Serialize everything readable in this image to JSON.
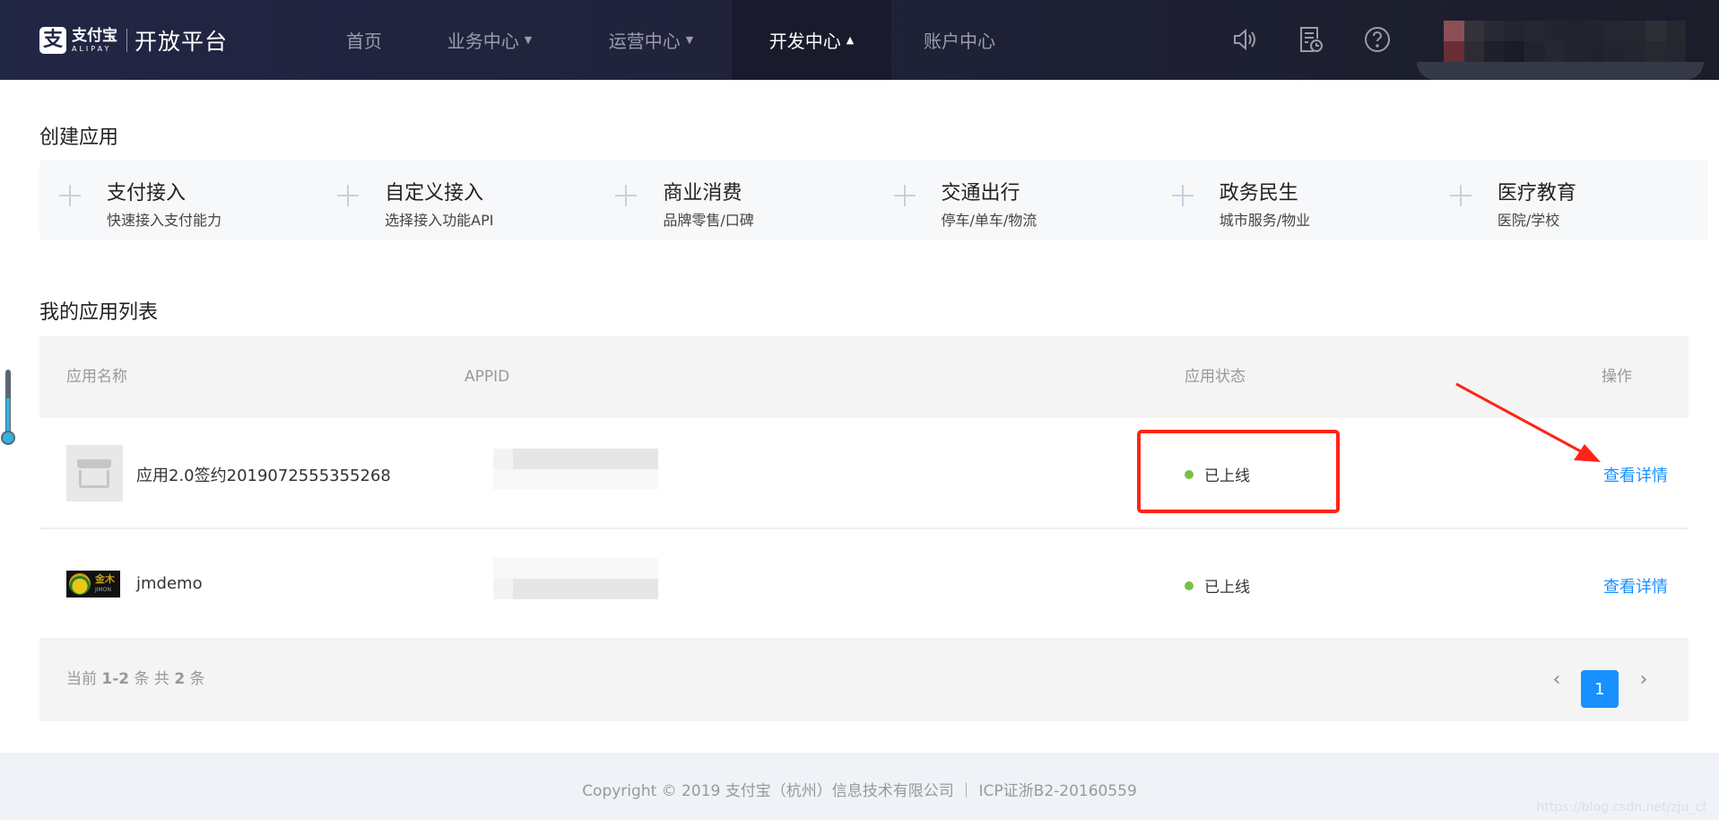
{
  "header": {
    "logo_mark": "支",
    "logo_cn": "支付宝",
    "logo_en": "ALIPAY",
    "platform_title": "开放平台",
    "nav": [
      {
        "label": "首页",
        "caret": ""
      },
      {
        "label": "业务中心",
        "caret": "▼"
      },
      {
        "label": "运营中心",
        "caret": "▼"
      },
      {
        "label": "开发中心",
        "caret": "▲",
        "active": true
      },
      {
        "label": "账户中心",
        "caret": ""
      }
    ],
    "icons": [
      "speaker-icon",
      "document-clock-icon",
      "help-icon"
    ]
  },
  "create_section": {
    "title": "创建应用",
    "cards": [
      {
        "title": "支付接入",
        "subtitle": "快速接入支付能力"
      },
      {
        "title": "自定义接入",
        "subtitle": "选择接入功能API"
      },
      {
        "title": "商业消费",
        "subtitle": "品牌零售/口碑"
      },
      {
        "title": "交通出行",
        "subtitle": "停车/单车/物流"
      },
      {
        "title": "政务民生",
        "subtitle": "城市服务/物业"
      },
      {
        "title": "医疗教育",
        "subtitle": "医院/学校"
      }
    ]
  },
  "apps_section": {
    "title": "我的应用列表",
    "columns": [
      "应用名称",
      "APPID",
      "应用状态",
      "操作"
    ],
    "rows": [
      {
        "name": "应用2.0签约2019072555355268",
        "appid": "",
        "status": "已上线",
        "action": "查看详情",
        "icon": "store-icon"
      },
      {
        "name": "jmdemo",
        "appid": "",
        "status": "已上线",
        "action": "查看详情",
        "icon": "jimon-logo",
        "logo_text": "金木",
        "logo_sub": "JIMON"
      }
    ],
    "status_color": "#7ac142",
    "link_color": "#1890ff"
  },
  "pagination": {
    "prefix": "当前",
    "range": "1-2",
    "mid": "条 共",
    "total": "2",
    "suffix": "条",
    "current_page": "1",
    "prev": "‹",
    "next": "›"
  },
  "footer": {
    "copyright": "Copyright © 2019 支付宝（杭州）信息技术有限公司 ｜ ICP证浙B2-20160559",
    "watermark": "https://blog.csdn.net/zju_cf"
  },
  "annotation": {
    "color": "#ff2417"
  }
}
